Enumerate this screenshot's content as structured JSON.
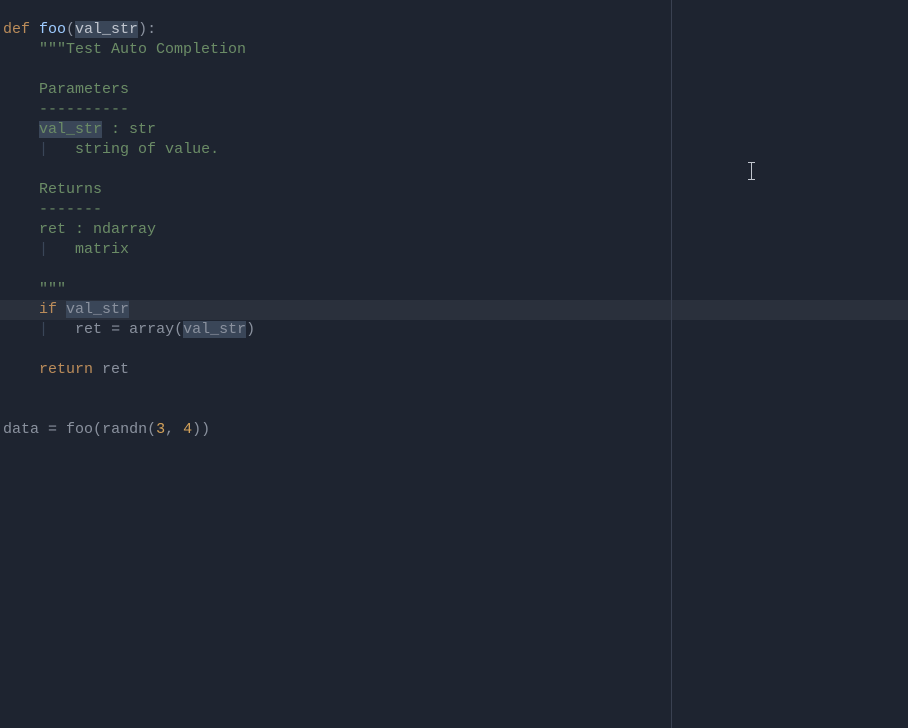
{
  "code": {
    "l1": {
      "def": "def ",
      "fn": "foo",
      "open": "(",
      "param": "val_str",
      "close": "):"
    },
    "l2": {
      "indent": "    ",
      "text": "\"\"\"Test Auto Completion"
    },
    "l3": "",
    "l4": {
      "indent": "    ",
      "text": "Parameters"
    },
    "l5": {
      "indent": "    ",
      "text": "----------"
    },
    "l6": {
      "indent": "    ",
      "param": "val_str",
      "rest": " : str"
    },
    "l7": {
      "indent": "    ",
      "guide": "|",
      "pad": "   ",
      "text": "string of value."
    },
    "l8": "",
    "l9": {
      "indent": "    ",
      "text": "Returns"
    },
    "l10": {
      "indent": "    ",
      "text": "-------"
    },
    "l11": {
      "indent": "    ",
      "text": "ret : ndarray"
    },
    "l12": {
      "indent": "    ",
      "guide": "|",
      "pad": "   ",
      "text": "matrix"
    },
    "l13": "",
    "l14": {
      "indent": "    ",
      "text": "\"\"\""
    },
    "l15": {
      "indent": "    ",
      "kw": "if ",
      "var": "val_str"
    },
    "l16": {
      "indent": "    ",
      "guide": "|",
      "pad": "   ",
      "ret": "ret",
      "eq": " = ",
      "fn": "array",
      "open": "(",
      "arg": "val_str",
      "close": ")"
    },
    "l17": "",
    "l18": {
      "indent": "    ",
      "kw": "return ",
      "var": "ret"
    },
    "l19": "",
    "l20": "",
    "l21": {
      "data": "data",
      "eq": " = ",
      "fn": "foo",
      "open": "(",
      "randn": "randn",
      "open2": "(",
      "n1": "3",
      "comma": ", ",
      "n2": "4",
      "close": "))"
    }
  },
  "chart_data": {
    "type": "table",
    "title": "Python source code",
    "lines": [
      "def foo(val_str):",
      "    \"\"\"Test Auto Completion",
      "",
      "    Parameters",
      "    ----------",
      "    val_str : str",
      "        string of value.",
      "",
      "    Returns",
      "    -------",
      "    ret : ndarray",
      "        matrix",
      "",
      "    \"\"\"",
      "    if val_str",
      "        ret = array(val_str)",
      "",
      "    return ret",
      "",
      "",
      "data = foo(randn(3, 4))"
    ],
    "current_line": 15,
    "highlighted_occurrences": [
      "val_str"
    ]
  }
}
